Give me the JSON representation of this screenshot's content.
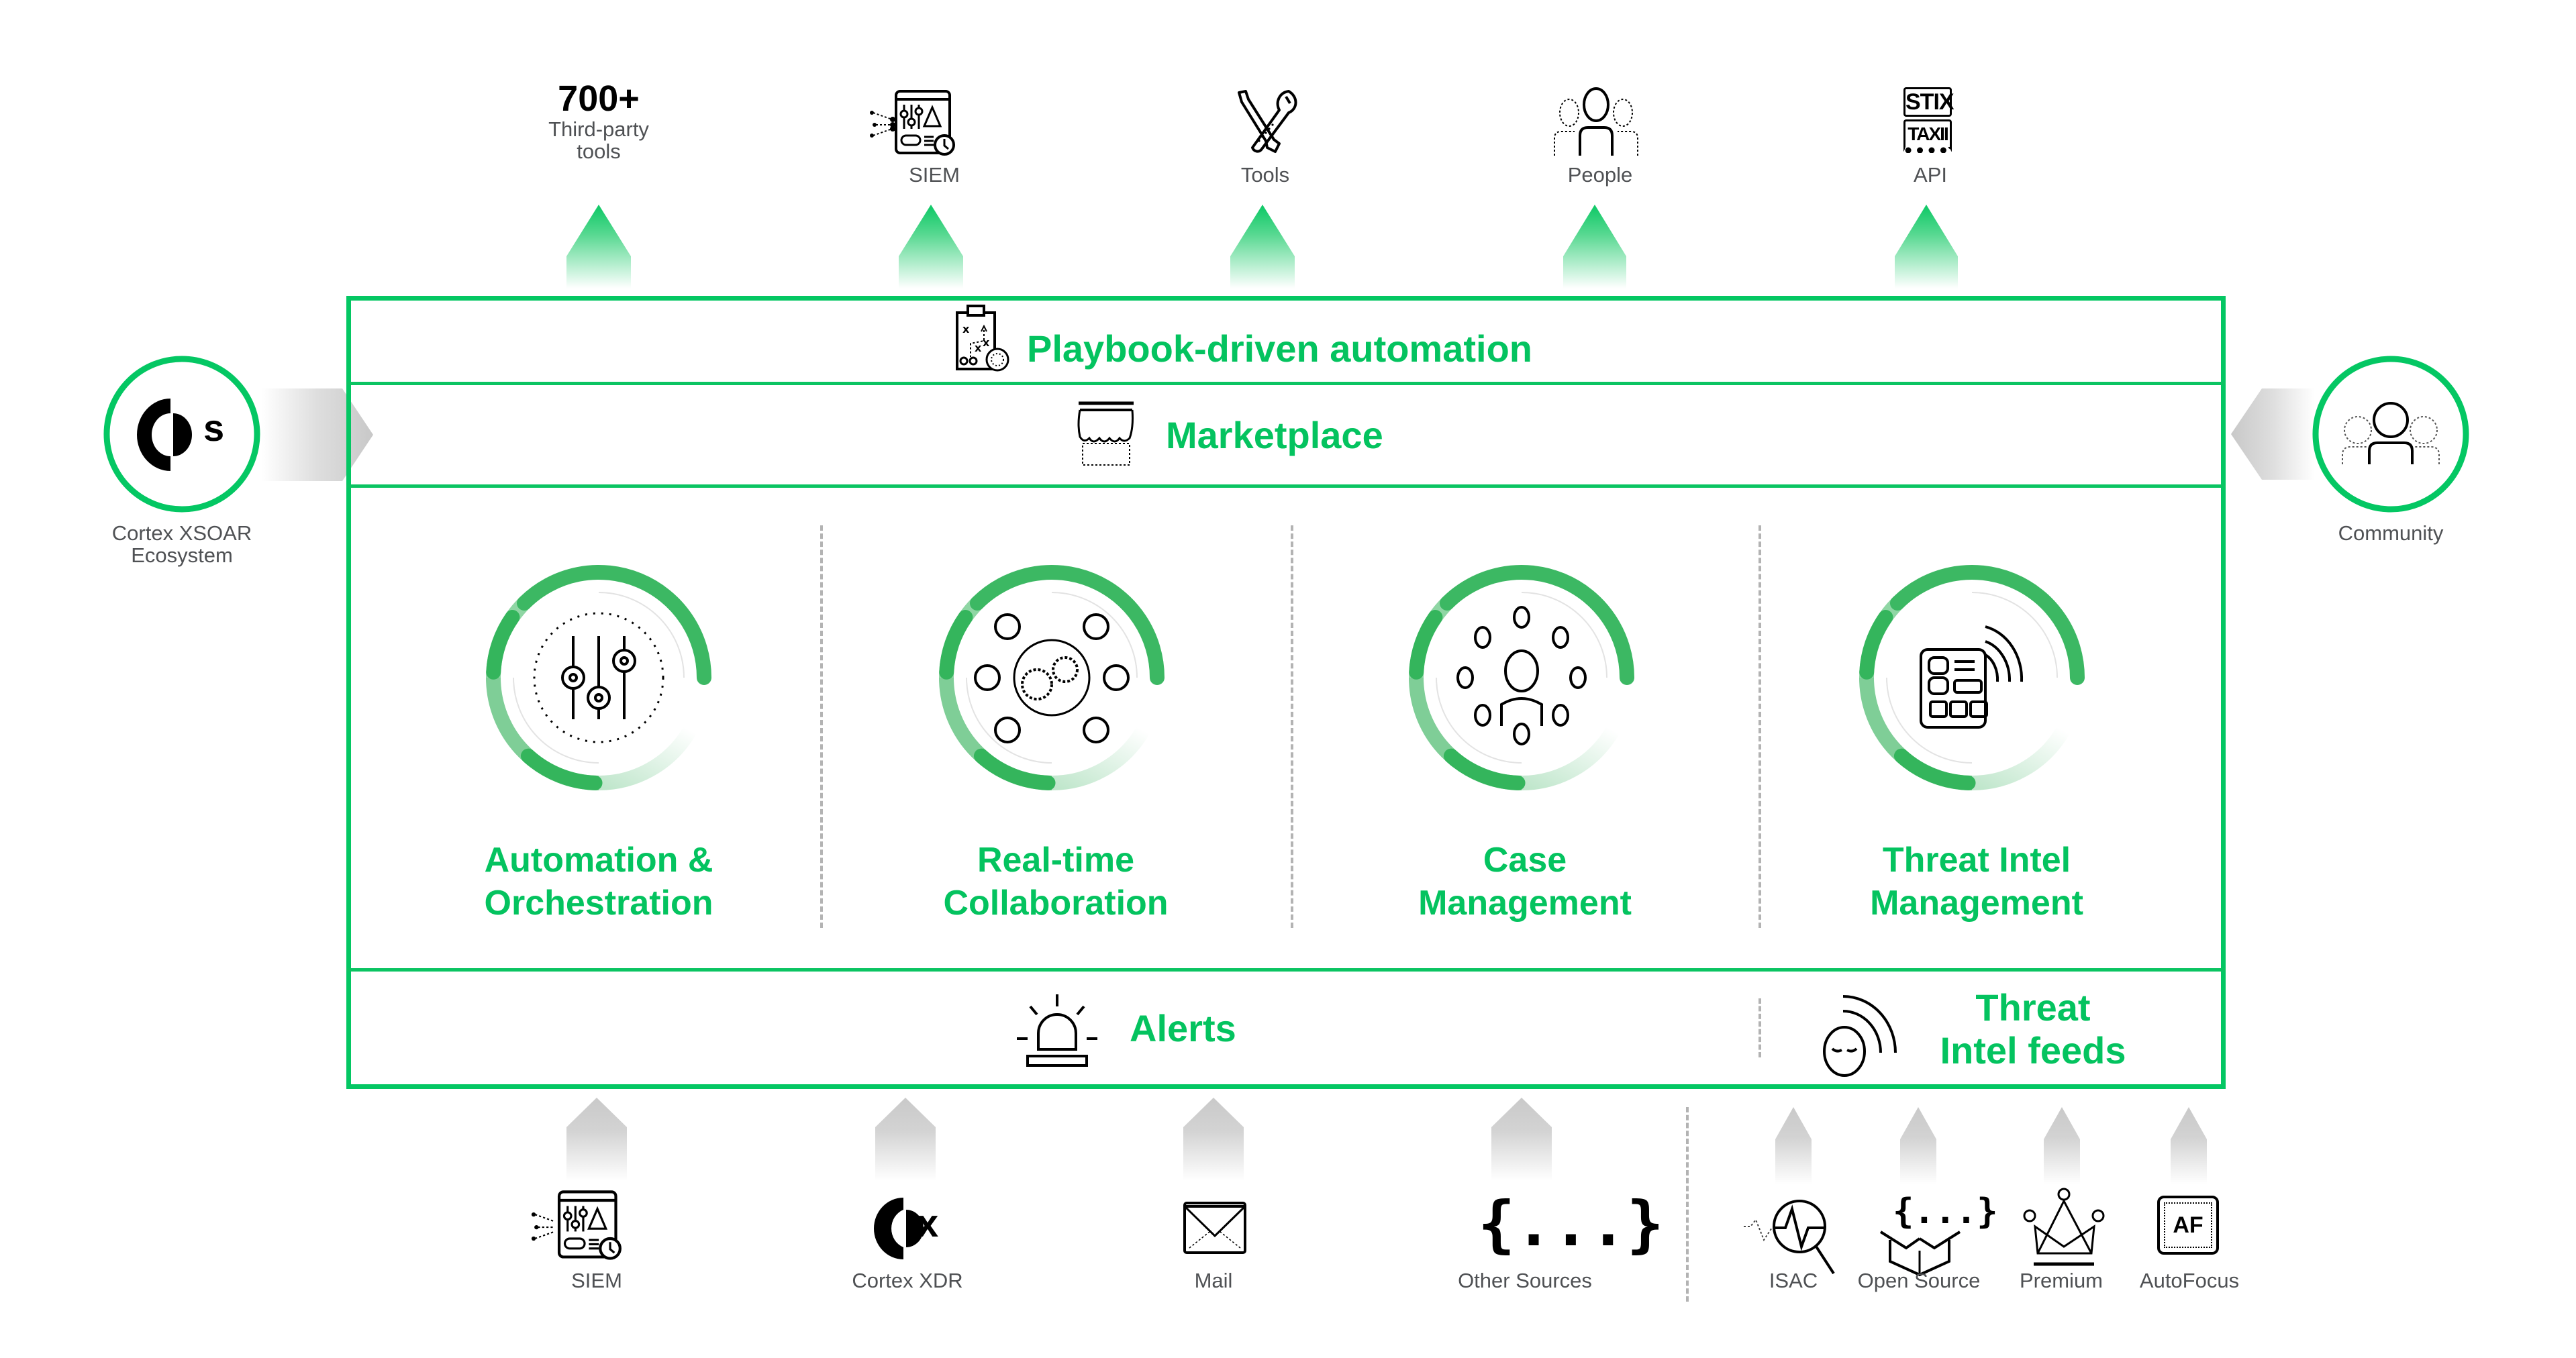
{
  "colors": {
    "brand_green": "#04c763",
    "arc_green": "#3bb864",
    "text_gray": "#4f5154",
    "arrow_gray": "#cfcfcf"
  },
  "top_outputs": {
    "third_party": {
      "count": "700+",
      "label_line1": "Third-party",
      "label_line2": "tools"
    },
    "items": [
      {
        "label": "SIEM",
        "icon": "siem-dashboard-icon"
      },
      {
        "label": "Tools",
        "icon": "tools-wrench-screwdriver-icon"
      },
      {
        "label": "People",
        "icon": "people-group-icon"
      },
      {
        "label": "API",
        "icon": "stix-taxii-icon",
        "icon_text_top": "STIX",
        "icon_text_bottom": "TAXII"
      }
    ]
  },
  "left_node": {
    "icon_letter": "s",
    "label_line1": "Cortex XSOAR",
    "label_line2": "Ecosystem"
  },
  "right_node": {
    "label": "Community",
    "icon": "community-people-icon"
  },
  "platform": {
    "playbook_row": {
      "title": "Playbook-driven automation",
      "icon": "playbook-clipboard-icon"
    },
    "marketplace_row": {
      "title": "Marketplace",
      "icon": "marketplace-awning-icon"
    },
    "capabilities": [
      {
        "line1": "Automation &",
        "line2": "Orchestration",
        "icon": "sliders-cycle-icon"
      },
      {
        "line1": "Real-time",
        "line2": "Collaboration",
        "icon": "gears-network-icon"
      },
      {
        "line1": "Case",
        "line2": "Management",
        "icon": "person-network-icon"
      },
      {
        "line1": "Threat Intel",
        "line2": "Management",
        "icon": "threat-intel-dashboard-icon"
      }
    ],
    "alerts": {
      "title": "Alerts",
      "icon": "siren-icon"
    },
    "threat_feeds": {
      "line1": "Threat",
      "line2": "Intel feeds",
      "icon": "hacker-signal-icon"
    }
  },
  "bottom_inputs": {
    "alert_sources": [
      {
        "label": "SIEM",
        "icon": "siem-dashboard-icon"
      },
      {
        "label": "Cortex XDR",
        "icon": "cortex-xdr-logo-icon",
        "icon_letter": "x"
      },
      {
        "label": "Mail",
        "icon": "mail-envelope-icon"
      },
      {
        "label": "Other Sources",
        "icon": "curly-braces-icon",
        "icon_text": "{...}"
      }
    ],
    "feed_sources": [
      {
        "label": "ISAC",
        "icon": "isac-magnifier-pulse-icon"
      },
      {
        "label": "Open Source",
        "icon": "open-box-code-icon",
        "icon_text": "{...}"
      },
      {
        "label": "Premium",
        "icon": "crown-icon"
      },
      {
        "label": "AutoFocus",
        "icon": "autofocus-af-icon",
        "icon_text": "AF"
      }
    ]
  }
}
